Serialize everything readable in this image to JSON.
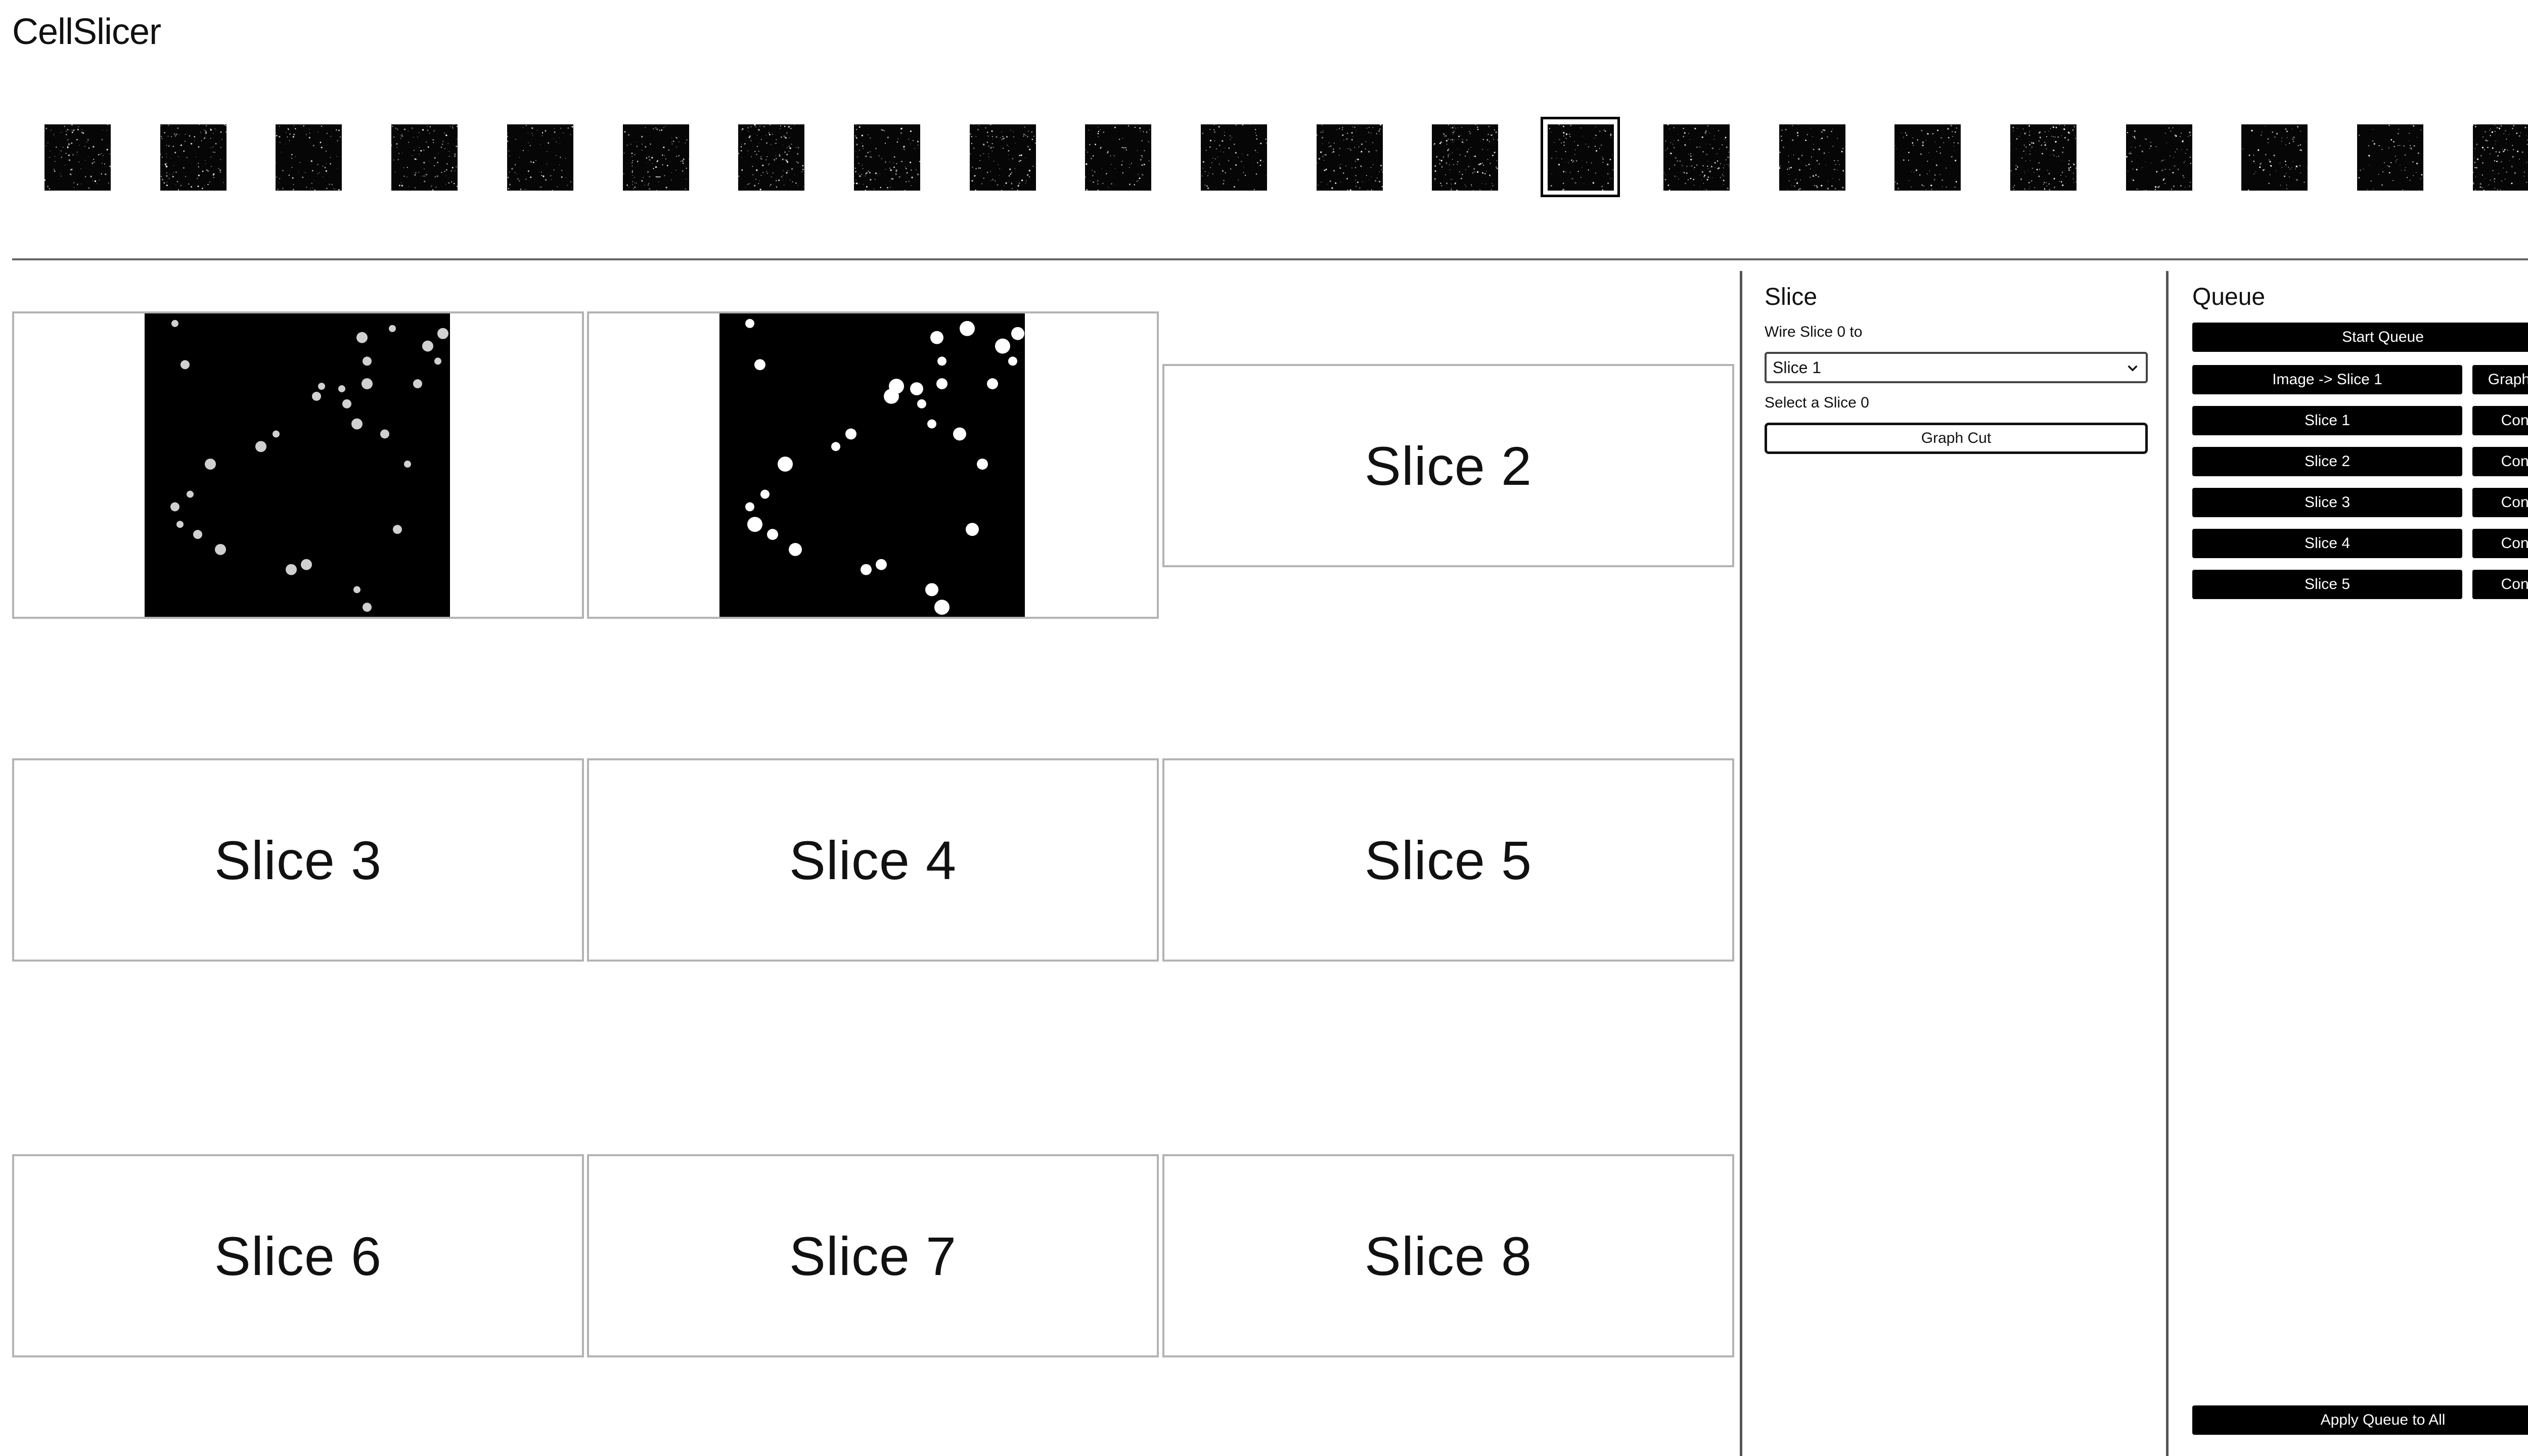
{
  "app": {
    "title": "CellSlicer"
  },
  "thumbnails": {
    "count": 22,
    "selected_index": 13
  },
  "slices": {
    "cards": [
      {
        "label": "",
        "has_image": true,
        "image_kind": "raw"
      },
      {
        "label": "",
        "has_image": true,
        "image_kind": "mask"
      },
      {
        "label": "Slice 2",
        "has_image": false
      },
      {
        "label": "Slice 3",
        "has_image": false
      },
      {
        "label": "Slice 4",
        "has_image": false
      },
      {
        "label": "Slice 5",
        "has_image": false
      },
      {
        "label": "Slice 6",
        "has_image": false
      },
      {
        "label": "Slice 7",
        "has_image": false
      },
      {
        "label": "Slice 8",
        "has_image": false
      }
    ]
  },
  "slice_panel": {
    "title": "Slice",
    "wire_label": "Wire Slice 0 to",
    "wire_select_value": "Slice 1",
    "select_label": "Select a Slice 0",
    "graph_cut_button": "Graph Cut"
  },
  "queue_panel": {
    "title": "Queue",
    "start_button": "Start Queue",
    "rows": [
      {
        "step": "Image -> Slice 1",
        "action": "Graph Cut"
      },
      {
        "step": "Slice 1",
        "action": "Config"
      },
      {
        "step": "Slice 2",
        "action": "Config"
      },
      {
        "step": "Slice 3",
        "action": "Config"
      },
      {
        "step": "Slice 4",
        "action": "Config"
      },
      {
        "step": "Slice 5",
        "action": "Config"
      }
    ],
    "apply_button": "Apply Queue to All"
  },
  "colors": {
    "background": "#ffffff",
    "button_bg": "#000000",
    "button_text": "#ffffff",
    "card_border": "#b3b3b3"
  }
}
